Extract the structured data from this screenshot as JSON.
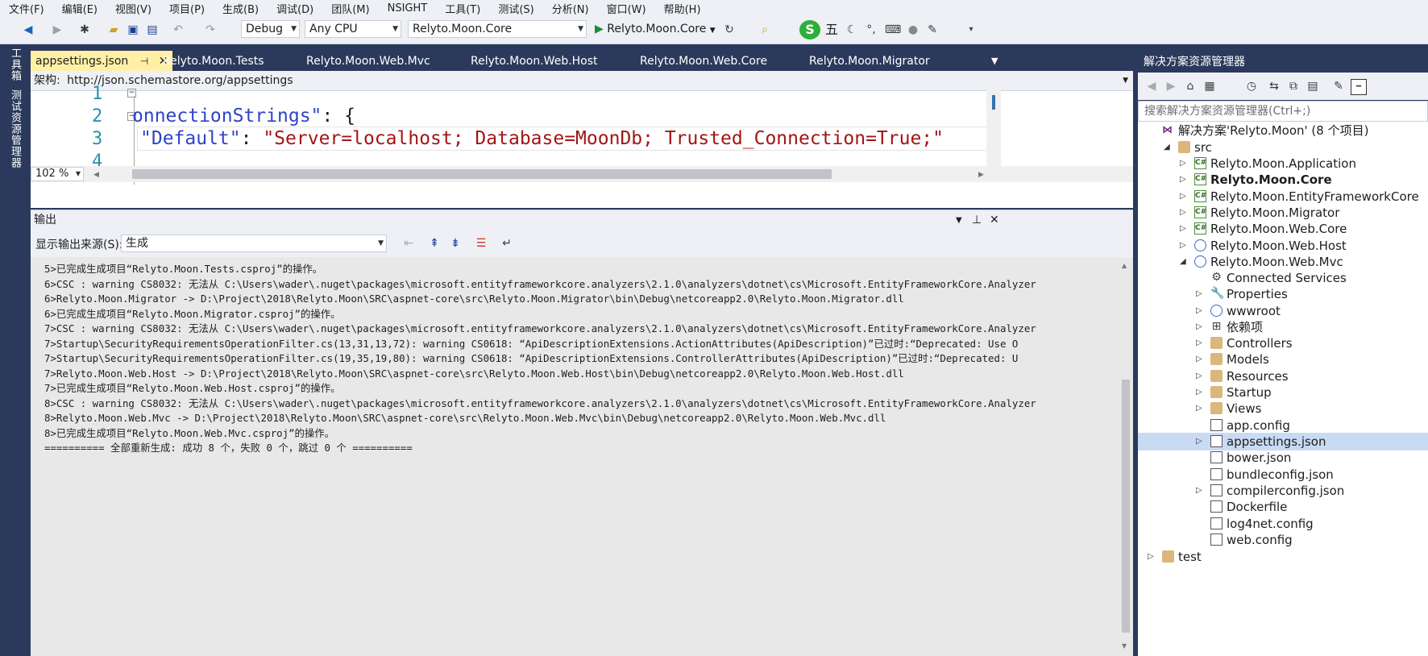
{
  "menu": [
    "文件(F)",
    "编辑(E)",
    "视图(V)",
    "项目(P)",
    "生成(B)",
    "调试(D)",
    "团队(M)",
    "NSIGHT",
    "工具(T)",
    "测试(S)",
    "分析(N)",
    "窗口(W)",
    "帮助(H)"
  ],
  "toolbar": {
    "config": "Debug",
    "platform": "Any CPU",
    "startup_project": "Relyto.Moon.Core",
    "run_target": "Relyto.Moon.Core",
    "ime_label": "五"
  },
  "left_strip": [
    "工具箱",
    "测试资源管理器"
  ],
  "doc_tabs": [
    "appsettings.json",
    "Relyto.Moon.Tests",
    "Relyto.Moon.Web.Mvc",
    "Relyto.Moon.Web.Host",
    "Relyto.Moon.Web.Core",
    "Relyto.Moon.Migrator"
  ],
  "editor": {
    "schema_label": "架构:",
    "schema_url": "http://json.schemastore.org/appsettings",
    "lines": [
      "1",
      "2",
      "3",
      "4"
    ],
    "line2_key": "onnectionStrings\"",
    "line2_rest": ": {",
    "line3_key": "\"Default\"",
    "line3_colon": ": ",
    "line3_value": "\"Server=localhost; Database=MoonDb; Trusted_Connection=True;\"",
    "zoom": "102 %"
  },
  "output": {
    "title": "输出",
    "source_label": "显示输出来源(S):",
    "source_value": "生成",
    "lines": [
      "5>已完成生成项目“Relyto.Moon.Tests.csproj”的操作。",
      "6>CSC : warning CS8032: 无法从 C:\\Users\\wader\\.nuget\\packages\\microsoft.entityframeworkcore.analyzers\\2.1.0\\analyzers\\dotnet\\cs\\Microsoft.EntityFrameworkCore.Analyzer",
      "6>Relyto.Moon.Migrator -> D:\\Project\\2018\\Relyto.Moon\\SRC\\aspnet-core\\src\\Relyto.Moon.Migrator\\bin\\Debug\\netcoreapp2.0\\Relyto.Moon.Migrator.dll",
      "6>已完成生成项目“Relyto.Moon.Migrator.csproj”的操作。",
      "7>CSC : warning CS8032: 无法从 C:\\Users\\wader\\.nuget\\packages\\microsoft.entityframeworkcore.analyzers\\2.1.0\\analyzers\\dotnet\\cs\\Microsoft.EntityFrameworkCore.Analyzer",
      "7>Startup\\SecurityRequirementsOperationFilter.cs(13,31,13,72): warning CS0618: “ApiDescriptionExtensions.ActionAttributes(ApiDescription)”已过时:“Deprecated: Use O",
      "7>Startup\\SecurityRequirementsOperationFilter.cs(19,35,19,80): warning CS0618: “ApiDescriptionExtensions.ControllerAttributes(ApiDescription)”已过时:“Deprecated: U",
      "7>Relyto.Moon.Web.Host -> D:\\Project\\2018\\Relyto.Moon\\SRC\\aspnet-core\\src\\Relyto.Moon.Web.Host\\bin\\Debug\\netcoreapp2.0\\Relyto.Moon.Web.Host.dll",
      "7>已完成生成项目“Relyto.Moon.Web.Host.csproj”的操作。",
      "8>CSC : warning CS8032: 无法从 C:\\Users\\wader\\.nuget\\packages\\microsoft.entityframeworkcore.analyzers\\2.1.0\\analyzers\\dotnet\\cs\\Microsoft.EntityFrameworkCore.Analyzer",
      "8>Relyto.Moon.Web.Mvc -> D:\\Project\\2018\\Relyto.Moon\\SRC\\aspnet-core\\src\\Relyto.Moon.Web.Mvc\\bin\\Debug\\netcoreapp2.0\\Relyto.Moon.Web.Mvc.dll",
      "8>已完成生成项目“Relyto.Moon.Web.Mvc.csproj”的操作。",
      "========== 全部重新生成: 成功 8 个，失败 0 个，跳过 0 个 =========="
    ]
  },
  "solution_explorer": {
    "title": "解决方案资源管理器",
    "search_placeholder": "搜索解决方案资源管理器(Ctrl+;)",
    "items": [
      {
        "label": "解决方案'Relyto.Moon' (8 个项目)",
        "icon": "solution-icon",
        "level": 0,
        "expander": ""
      },
      {
        "label": "src",
        "icon": "folder-icon",
        "level": 1,
        "expander": "◢"
      },
      {
        "label": "Relyto.Moon.Application",
        "icon": "csharp-project-icon",
        "level": 2,
        "expander": "▷"
      },
      {
        "label": "Relyto.Moon.Core",
        "icon": "csharp-project-icon",
        "level": 2,
        "expander": "▷",
        "bold": true
      },
      {
        "label": "Relyto.Moon.EntityFrameworkCore",
        "icon": "csharp-project-icon",
        "level": 2,
        "expander": "▷"
      },
      {
        "label": "Relyto.Moon.Migrator",
        "icon": "csharp-project-icon",
        "level": 2,
        "expander": "▷"
      },
      {
        "label": "Relyto.Moon.Web.Core",
        "icon": "csharp-project-icon",
        "level": 2,
        "expander": "▷"
      },
      {
        "label": "Relyto.Moon.Web.Host",
        "icon": "web-project-icon",
        "level": 2,
        "expander": "▷"
      },
      {
        "label": "Relyto.Moon.Web.Mvc",
        "icon": "web-project-icon",
        "level": 2,
        "expander": "◢"
      },
      {
        "label": "Connected Services",
        "icon": "connected-services-icon",
        "level": 3,
        "expander": ""
      },
      {
        "label": "Properties",
        "icon": "wrench-icon",
        "level": 3,
        "expander": "▷"
      },
      {
        "label": "wwwroot",
        "icon": "globe-icon",
        "level": 3,
        "expander": "▷"
      },
      {
        "label": "依赖项",
        "icon": "dependencies-icon",
        "level": 3,
        "expander": "▷"
      },
      {
        "label": "Controllers",
        "icon": "folder-icon",
        "level": 3,
        "expander": "▷"
      },
      {
        "label": "Models",
        "icon": "folder-icon",
        "level": 3,
        "expander": "▷"
      },
      {
        "label": "Resources",
        "icon": "folder-icon",
        "level": 3,
        "expander": "▷"
      },
      {
        "label": "Startup",
        "icon": "folder-icon",
        "level": 3,
        "expander": "▷"
      },
      {
        "label": "Views",
        "icon": "folder-icon",
        "level": 3,
        "expander": "▷"
      },
      {
        "label": "app.config",
        "icon": "config-file-icon",
        "level": 3,
        "expander": ""
      },
      {
        "label": "appsettings.json",
        "icon": "json-file-icon",
        "level": 3,
        "expander": "▷",
        "selected": true
      },
      {
        "label": "bower.json",
        "icon": "json-file-icon",
        "level": 3,
        "expander": ""
      },
      {
        "label": "bundleconfig.json",
        "icon": "json-file-icon",
        "level": 3,
        "expander": ""
      },
      {
        "label": "compilerconfig.json",
        "icon": "json-file-icon",
        "level": 3,
        "expander": "▷"
      },
      {
        "label": "Dockerfile",
        "icon": "file-icon",
        "level": 3,
        "expander": ""
      },
      {
        "label": "log4net.config",
        "icon": "config-file-icon",
        "level": 3,
        "expander": ""
      },
      {
        "label": "web.config",
        "icon": "config-file-icon",
        "level": 3,
        "expander": ""
      },
      {
        "label": "test",
        "icon": "folder-icon",
        "level": 0,
        "expander": "▷"
      }
    ]
  }
}
